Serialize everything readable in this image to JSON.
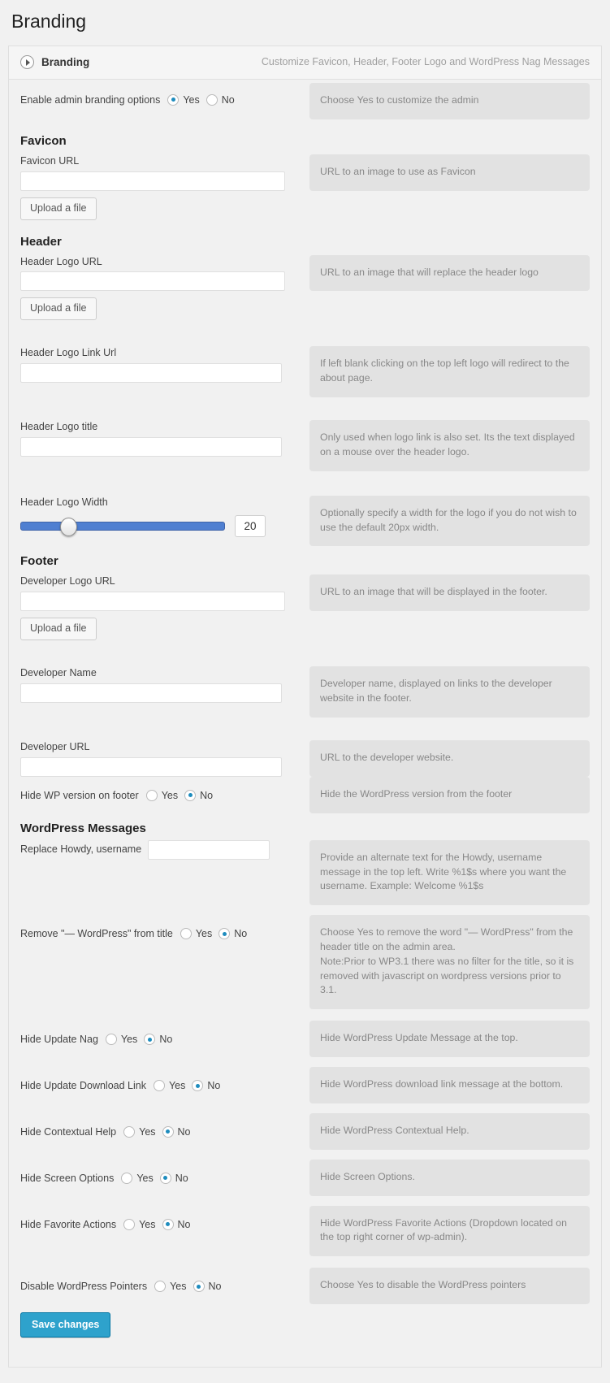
{
  "page": {
    "title": "Branding"
  },
  "panel": {
    "title": "Branding",
    "subtitle": "Customize Favicon, Header, Footer Logo and WordPress Nag Messages",
    "toggle_icon": "play-triangle-icon"
  },
  "options": {
    "yes": "Yes",
    "no": "No"
  },
  "enable_branding": {
    "label": "Enable admin branding options",
    "value": "Yes",
    "desc": "Choose Yes to customize the admin"
  },
  "sections": {
    "favicon": "Favicon",
    "header": "Header",
    "footer": "Footer",
    "wp_messages": "WordPress Messages"
  },
  "upload_button": "Upload a file",
  "favicon_url": {
    "label": "Favicon URL",
    "value": "",
    "desc": "URL to an image to use as Favicon"
  },
  "header_logo_url": {
    "label": "Header Logo URL",
    "value": "",
    "desc": "URL to an image that will replace the header logo"
  },
  "header_logo_link_url": {
    "label": "Header Logo Link Url",
    "value": "",
    "desc": "If left blank clicking on the top left logo will redirect to the about page."
  },
  "header_logo_title": {
    "label": "Header Logo title",
    "value": "",
    "desc": "Only used when logo link is also set. Its the text displayed on a mouse over the header logo."
  },
  "header_logo_width": {
    "label": "Header Logo Width",
    "value": "20",
    "percent": 23,
    "desc": "Optionally specify a width for the logo if you do not wish to use the default 20px width.",
    "track_color": "#4f7fd1"
  },
  "developer_logo_url": {
    "label": "Developer Logo URL",
    "value": "",
    "desc": "URL to an image that will be displayed in the footer."
  },
  "developer_name": {
    "label": "Developer Name",
    "value": "",
    "desc": "Developer name, displayed on links to the developer website in the footer."
  },
  "developer_url": {
    "label": "Developer URL",
    "value": "",
    "desc": "URL to the developer website."
  },
  "hide_wp_version": {
    "label": "Hide WP version on footer",
    "value": "No",
    "desc": "Hide the WordPress version from the footer"
  },
  "replace_howdy": {
    "label": "Replace Howdy, username",
    "value": "",
    "desc": "Provide an alternate text for the Howdy, username message in the top left. Write %1$s where you want the username. Example: Welcome %1$s"
  },
  "remove_wordpress_title": {
    "label": "Remove \"— WordPress\" from title",
    "value": "No",
    "desc": "Choose Yes to remove the word \"— WordPress\" from the header title on the admin area.\nNote:Prior to WP3.1 there was no filter for the title, so it is removed with javascript on wordpress versions prior to 3.1."
  },
  "hide_update_nag": {
    "label": "Hide Update Nag",
    "value": "No",
    "desc": "Hide WordPress Update Message at the top."
  },
  "hide_update_download_link": {
    "label": "Hide Update Download Link",
    "value": "No",
    "desc": "Hide WordPress download link message at the bottom."
  },
  "hide_contextual_help": {
    "label": "Hide Contextual Help",
    "value": "No",
    "desc": "Hide WordPress Contextual Help."
  },
  "hide_screen_options": {
    "label": "Hide Screen Options",
    "value": "No",
    "desc": "Hide Screen Options."
  },
  "hide_favorite_actions": {
    "label": "Hide Favorite Actions",
    "value": "No",
    "desc": "Hide WordPress Favorite Actions (Dropdown located on the top right corner of wp-admin)."
  },
  "disable_pointers": {
    "label": "Disable WordPress Pointers",
    "value": "No",
    "desc": "Choose Yes to disable the WordPress pointers"
  },
  "save": {
    "label": "Save changes",
    "color": "#2ea2cc"
  }
}
